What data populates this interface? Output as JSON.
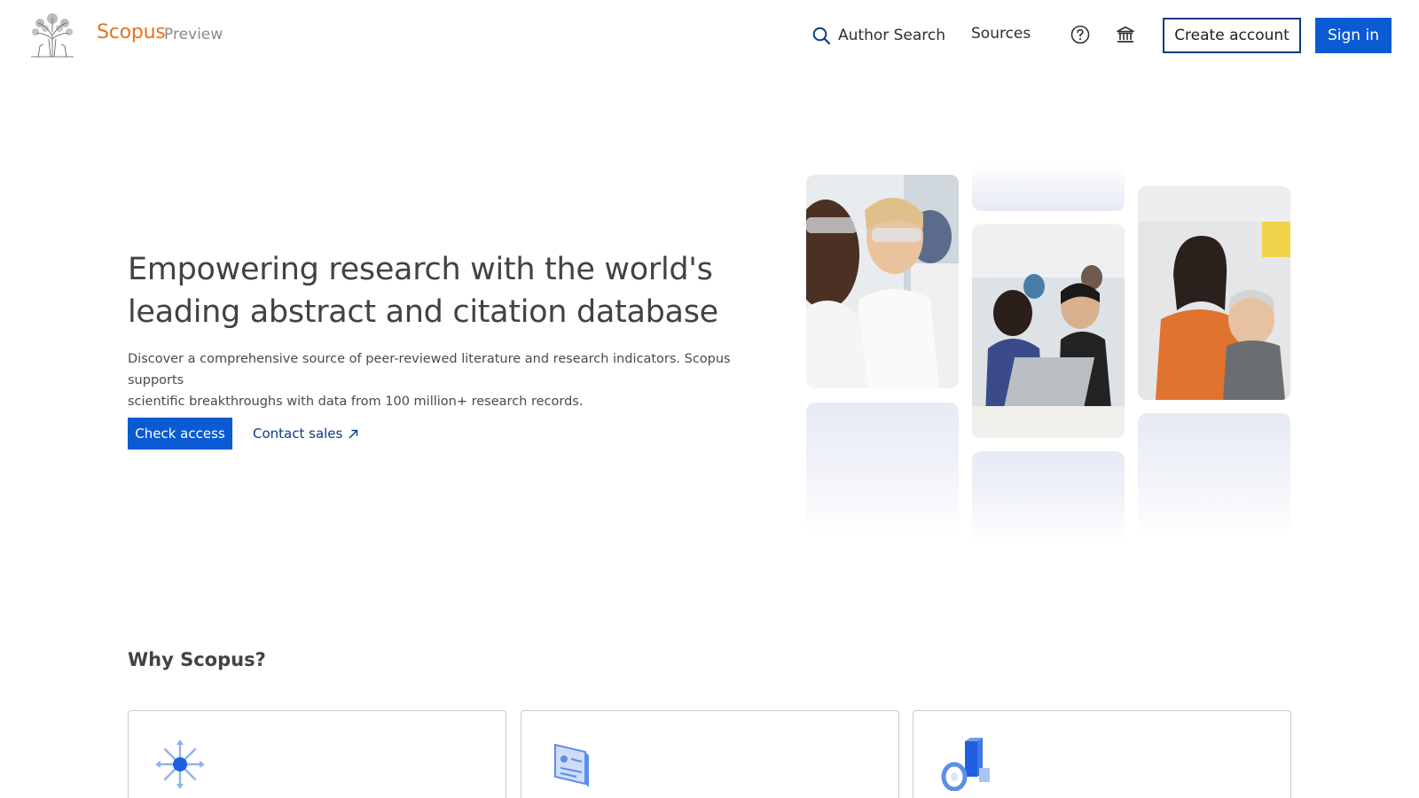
{
  "header": {
    "brand": "Scopus",
    "brand_sub": "Preview",
    "nav": {
      "author_search": "Author Search",
      "sources": "Sources"
    },
    "create_account": "Create account",
    "sign_in": "Sign in"
  },
  "hero": {
    "title_line1": "Empowering research with the world's",
    "title_line2": "leading abstract and citation database",
    "desc_line1": "Discover a comprehensive source of peer-reviewed literature and research indicators. Scopus supports",
    "desc_line2": "scientific breakthroughs with data from 100 million+ research records.",
    "check_access": "Check access",
    "contact_sales": "Contact sales"
  },
  "why": {
    "title": "Why Scopus?"
  },
  "colors": {
    "accent_blue": "#0a5bd3",
    "navy": "#0b3a82",
    "brand_orange": "#e9711c"
  }
}
